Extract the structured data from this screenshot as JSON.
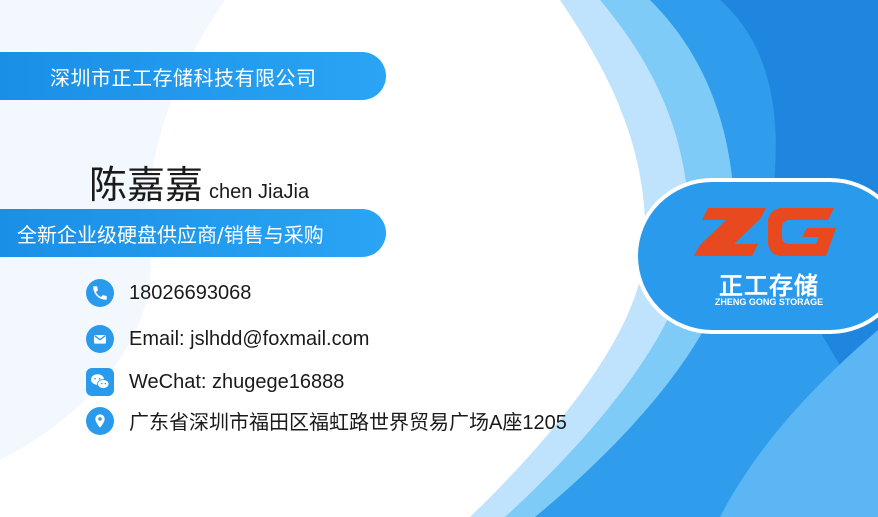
{
  "card": {
    "company": "深圳市正工存储科技有限公司",
    "name_cn": "陈嘉嘉",
    "name_en": "chen JiaJia",
    "tagline": "全新企业级硬盘供应商/销售与采购",
    "phone": "18026693068",
    "email": "Email: jslhdd@foxmail.com",
    "wechat": "WeChat: zhugege16888",
    "address": "广东省深圳市福田区福虹路世界贸易广场A座1205",
    "logo": {
      "letters": "ZG",
      "brand_cn": "正工存储",
      "brand_en": "ZHENG GONG STORAGE"
    },
    "icons": {
      "phone": "phone-icon",
      "email": "mail-icon",
      "wechat": "wechat-icon",
      "address": "location-pin-icon"
    },
    "colors": {
      "blue": "#2a9aed",
      "light_blue": "#8fd0fb",
      "orange": "#e8491e",
      "white": "#ffffff"
    }
  }
}
